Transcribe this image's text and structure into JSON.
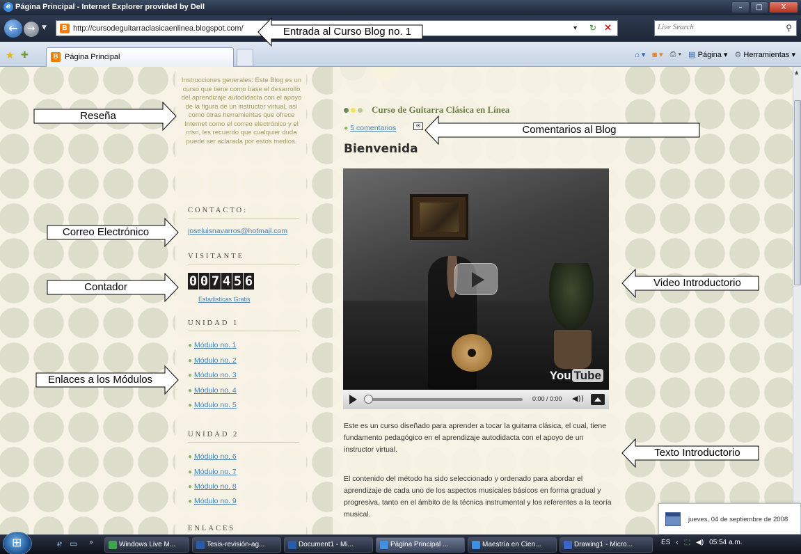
{
  "window": {
    "title": "Página Principal - Internet Explorer provided by Dell",
    "min": "–",
    "max": "□",
    "close": "X"
  },
  "address": {
    "url": "http://cursodeguitarraclasicaenlinea.blogspot.com/",
    "search_placeholder": "Live Search"
  },
  "tab": {
    "label": "Página Principal"
  },
  "commands": {
    "page": "Página ▾",
    "tools": "Herramientas ▾"
  },
  "sidebar": {
    "intro": "Instrucciones generales: Este Blog es un curso que tiene como base el desarrollo del aprendizaje autodidacta con el apoyo de la figura de un instructor virtual, así como otras herramientas que ofrece Internet como el correo electrónico y el msn, les recuerdo que cualquier duda puede ser aclarada por estos medios.",
    "contact_heading": "CONTACTO:",
    "email": "joseluisnavarros@hotmail.com",
    "visitors_heading": "VISITANTE",
    "counter_digits": [
      "0",
      "0",
      "7",
      "4",
      "5",
      "6"
    ],
    "stats_link": "Estadisticas Gratis",
    "unit1_heading": "UNIDAD 1",
    "unit1_modules": [
      "Módulo no. 1",
      "Módulo no. 2",
      "Módulo no. 3",
      "Módulo no. 4",
      "Módulo no. 5"
    ],
    "unit2_heading": "UNIDAD 2",
    "unit2_modules": [
      "Módulo no. 6",
      "Módulo no. 7",
      "Módulo no. 8",
      "Módulo no. 9"
    ],
    "links_heading": "ENLACES"
  },
  "post": {
    "blog_title": "Curso de Guitarra Clásica en Línea",
    "comments": "5 comentarios",
    "heading": "Bienvenida",
    "video_time": "0:00 / 0:00",
    "youtube_you": "You",
    "youtube_tube": "Tube",
    "para1": "Este es un curso diseñado para aprender a tocar la guitarra clásica, el cual, tiene fundamento pedagógico en el aprendizaje autodidacta con el apoyo de un instructor virtual.",
    "para2": "El contenido del método ha sido seleccionado y ordenado para abordar el aprendizaje de cada uno de los aspectos musicales básicos en forma gradual y progresiva, tanto en el ámbito de la técnica instrumental y los referentes a la teoría musical."
  },
  "annotations": {
    "entrada": "Entrada al Curso Blog no. 1",
    "resena": "Reseña",
    "correo": "Correo Electrónico",
    "contador": "Contador",
    "enlaces": "Enlaces a los Módulos",
    "comentarios": "Comentarios al Blog",
    "video": "Video Introductorio",
    "texto": "Texto Introductorio"
  },
  "notification": {
    "date": "jueves, 04 de septiembre de 2008"
  },
  "taskbar": {
    "items": [
      "Windows Live M...",
      "Tesis-revisión-ag...",
      "Document1 - Mi...",
      "Página Principal ...",
      "Maestría en Cien...",
      "Drawing1 - Micro..."
    ],
    "lang": "ES",
    "time": "05:54 a.m."
  },
  "colors": {
    "accent_green": "#6a8c52",
    "accent_yellow": "#f5e155",
    "link_blue": "#4a7fae"
  }
}
